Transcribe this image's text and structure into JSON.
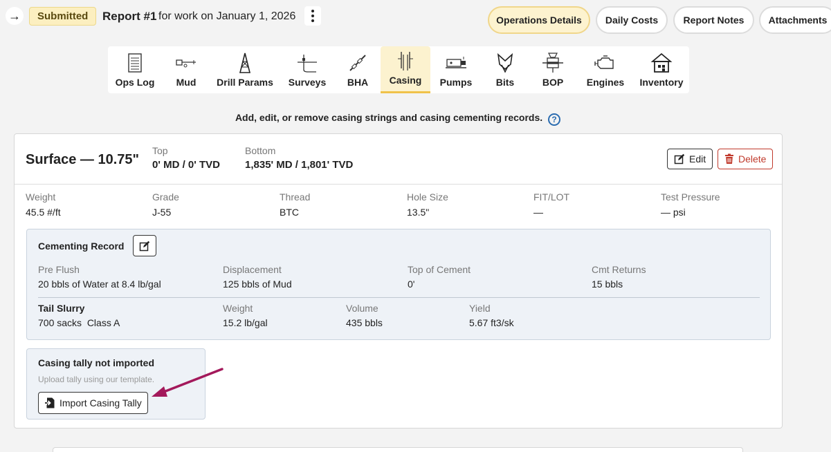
{
  "header": {
    "status": "Submitted",
    "report_title": "Report #1",
    "report_subtitle": "for work on January 1, 2026",
    "tabs": [
      {
        "label": "Operations Details",
        "active": true
      },
      {
        "label": "Daily Costs",
        "active": false
      },
      {
        "label": "Report Notes",
        "active": false
      },
      {
        "label": "Attachments",
        "active": false
      }
    ]
  },
  "toolbar": {
    "items": [
      {
        "label": "Ops Log",
        "icon": "ops-log-icon"
      },
      {
        "label": "Mud",
        "icon": "mud-icon"
      },
      {
        "label": "Drill Params",
        "icon": "drill-params-icon"
      },
      {
        "label": "Surveys",
        "icon": "surveys-icon"
      },
      {
        "label": "BHA",
        "icon": "bha-icon"
      },
      {
        "label": "Casing",
        "icon": "casing-icon",
        "active": true
      },
      {
        "label": "Pumps",
        "icon": "pumps-icon"
      },
      {
        "label": "Bits",
        "icon": "bits-icon"
      },
      {
        "label": "BOP",
        "icon": "bop-icon"
      },
      {
        "label": "Engines",
        "icon": "engines-icon"
      },
      {
        "label": "Inventory",
        "icon": "inventory-icon"
      }
    ]
  },
  "hint": "Add, edit, or remove casing strings and casing cementing records.",
  "casing": {
    "title": "Surface — 10.75\"",
    "top_label": "Top",
    "top_value": "0' MD / 0' TVD",
    "bottom_label": "Bottom",
    "bottom_value": "1,835' MD / 1,801' TVD",
    "edit_label": "Edit",
    "delete_label": "Delete",
    "props": [
      {
        "label": "Weight",
        "value": "45.5 #/ft"
      },
      {
        "label": "Grade",
        "value": "J-55"
      },
      {
        "label": "Thread",
        "value": "BTC"
      },
      {
        "label": "Hole Size",
        "value": "13.5\""
      },
      {
        "label": "FIT/LOT",
        "value": "—"
      },
      {
        "label": "Test Pressure",
        "value": "— psi"
      }
    ]
  },
  "cementing": {
    "title": "Cementing Record",
    "fields": [
      {
        "label": "Pre Flush",
        "value": "20 bbls of Water at 8.4 lb/gal"
      },
      {
        "label": "Displacement",
        "value": "125 bbls of Mud"
      },
      {
        "label": "Top of Cement",
        "value": "0'"
      },
      {
        "label": "Cmt Returns",
        "value": "15 bbls"
      }
    ],
    "tail": {
      "label": "Tail Slurry",
      "value": "700 sacks  Class A",
      "fields": [
        {
          "label": "Weight",
          "value": "15.2 lb/gal"
        },
        {
          "label": "Volume",
          "value": "435 bbls"
        },
        {
          "label": "Yield",
          "value": "5.67 ft3/sk"
        }
      ]
    }
  },
  "tally": {
    "title": "Casing tally not imported",
    "note": "Upload tally using our template.",
    "button_label": "Import Casing Tally"
  },
  "colors": {
    "accent": "#f0c24a",
    "delete": "#c0392b",
    "help": "#2b6cb0",
    "arrow": "#a3195b"
  }
}
